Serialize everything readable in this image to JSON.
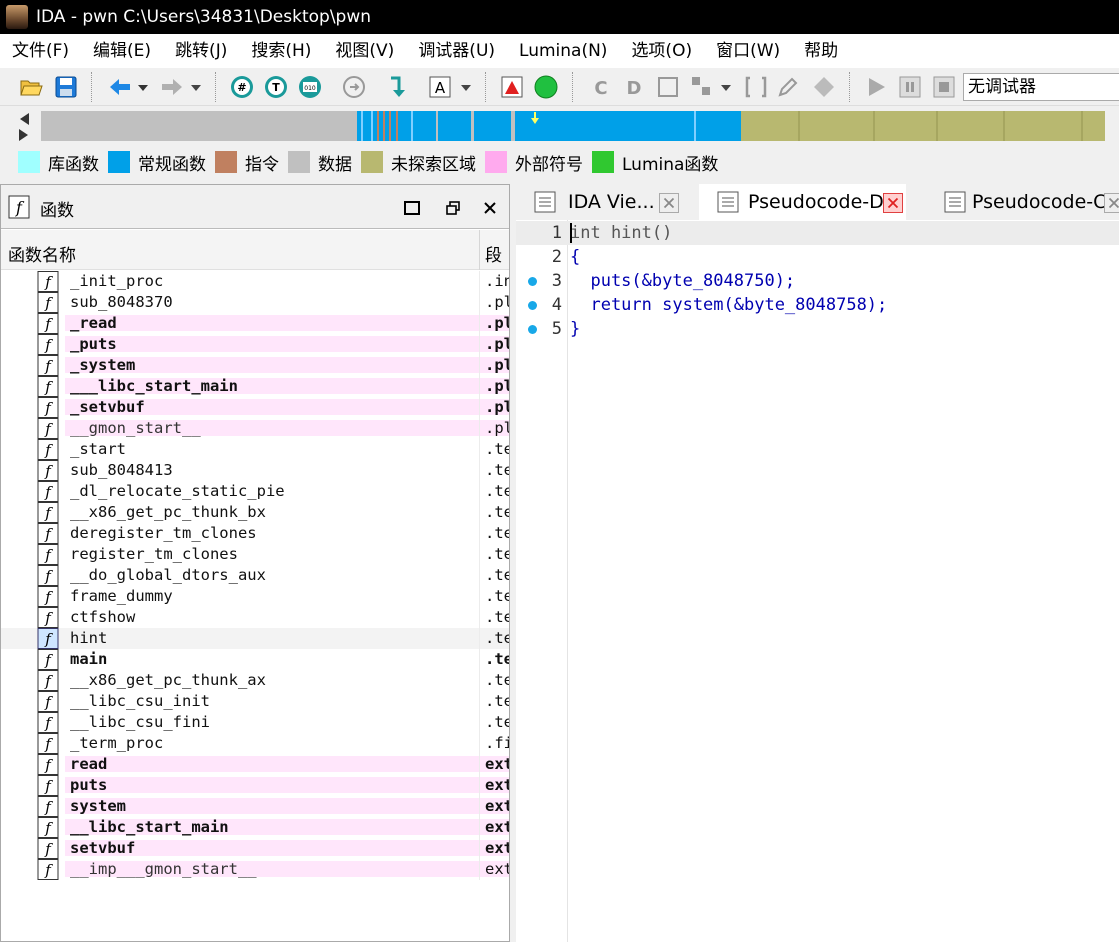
{
  "window": {
    "title": "IDA - pwn C:\\Users\\34831\\Desktop\\pwn"
  },
  "menu": [
    "文件(F)",
    "编辑(E)",
    "跳转(J)",
    "搜索(H)",
    "视图(V)",
    "调试器(U)",
    "Lumina(N)",
    "选项(O)",
    "窗口(W)",
    "帮助"
  ],
  "toolbar": {
    "debugger_select": "无调试器"
  },
  "legend": [
    {
      "label": "库函数",
      "color": "#a0ffff"
    },
    {
      "label": "常规函数",
      "color": "#00a0e8"
    },
    {
      "label": "指令",
      "color": "#c08060"
    },
    {
      "label": "数据",
      "color": "#c0c0c0"
    },
    {
      "label": "未探索区域",
      "color": "#b8b870"
    },
    {
      "label": "外部符号",
      "color": "#ffaaee"
    },
    {
      "label": "Lumina函数",
      "color": "#30c830"
    }
  ],
  "functions_panel": {
    "title": "函数",
    "col_name": "函数名称",
    "col_segment": "段",
    "rows": [
      {
        "name": "_init_proc",
        "segment": ".init",
        "style": "normal"
      },
      {
        "name": "sub_8048370",
        "segment": ".plt",
        "style": "normal"
      },
      {
        "name": "_read",
        "segment": ".plt",
        "style": "bold-hl"
      },
      {
        "name": "_puts",
        "segment": ".plt",
        "style": "bold-hl"
      },
      {
        "name": "_system",
        "segment": ".plt",
        "style": "bold-hl"
      },
      {
        "name": "___libc_start_main",
        "segment": ".plt",
        "style": "bold-hl"
      },
      {
        "name": "_setvbuf",
        "segment": ".plt",
        "style": "bold-hl"
      },
      {
        "name": "__gmon_start__",
        "segment": ".plt",
        "style": "hl"
      },
      {
        "name": "_start",
        "segment": ".text",
        "style": "normal"
      },
      {
        "name": "sub_8048413",
        "segment": ".text",
        "style": "normal"
      },
      {
        "name": "_dl_relocate_static_pie",
        "segment": ".text",
        "style": "normal"
      },
      {
        "name": "__x86_get_pc_thunk_bx",
        "segment": ".text",
        "style": "normal"
      },
      {
        "name": "deregister_tm_clones",
        "segment": ".text",
        "style": "normal"
      },
      {
        "name": "register_tm_clones",
        "segment": ".text",
        "style": "normal"
      },
      {
        "name": "__do_global_dtors_aux",
        "segment": ".text",
        "style": "normal"
      },
      {
        "name": "frame_dummy",
        "segment": ".text",
        "style": "normal"
      },
      {
        "name": "ctfshow",
        "segment": ".text",
        "style": "normal"
      },
      {
        "name": "hint",
        "segment": ".text",
        "style": "selected"
      },
      {
        "name": "main",
        "segment": ".text",
        "style": "bold"
      },
      {
        "name": "__x86_get_pc_thunk_ax",
        "segment": ".text",
        "style": "normal"
      },
      {
        "name": "__libc_csu_init",
        "segment": ".text",
        "style": "normal"
      },
      {
        "name": "__libc_csu_fini",
        "segment": ".text",
        "style": "normal"
      },
      {
        "name": "_term_proc",
        "segment": ".fini",
        "style": "normal"
      },
      {
        "name": "read",
        "segment": "extern",
        "style": "bold-hl"
      },
      {
        "name": "puts",
        "segment": "extern",
        "style": "bold-hl"
      },
      {
        "name": "system",
        "segment": "extern",
        "style": "bold-hl"
      },
      {
        "name": "__libc_start_main",
        "segment": "extern",
        "style": "bold-hl"
      },
      {
        "name": "setvbuf",
        "segment": "extern",
        "style": "bold-hl"
      },
      {
        "name": "__imp___gmon_start__",
        "segment": "extern",
        "style": "hl"
      }
    ]
  },
  "tabs": [
    {
      "label": "IDA Vie..."
    },
    {
      "label": "Pseudocode-D"
    },
    {
      "label": "Pseudocode-C"
    }
  ],
  "code": {
    "lines": [
      {
        "num": "1",
        "text": "int hint()",
        "dot": false,
        "current": true
      },
      {
        "num": "2",
        "text": "{",
        "dot": false,
        "current": false
      },
      {
        "num": "3",
        "text": "  puts(&byte_8048750);",
        "dot": true,
        "current": false
      },
      {
        "num": "4",
        "text": "  return system(&byte_8048758);",
        "dot": true,
        "current": false
      },
      {
        "num": "5",
        "text": "}",
        "dot": true,
        "current": false
      }
    ]
  }
}
